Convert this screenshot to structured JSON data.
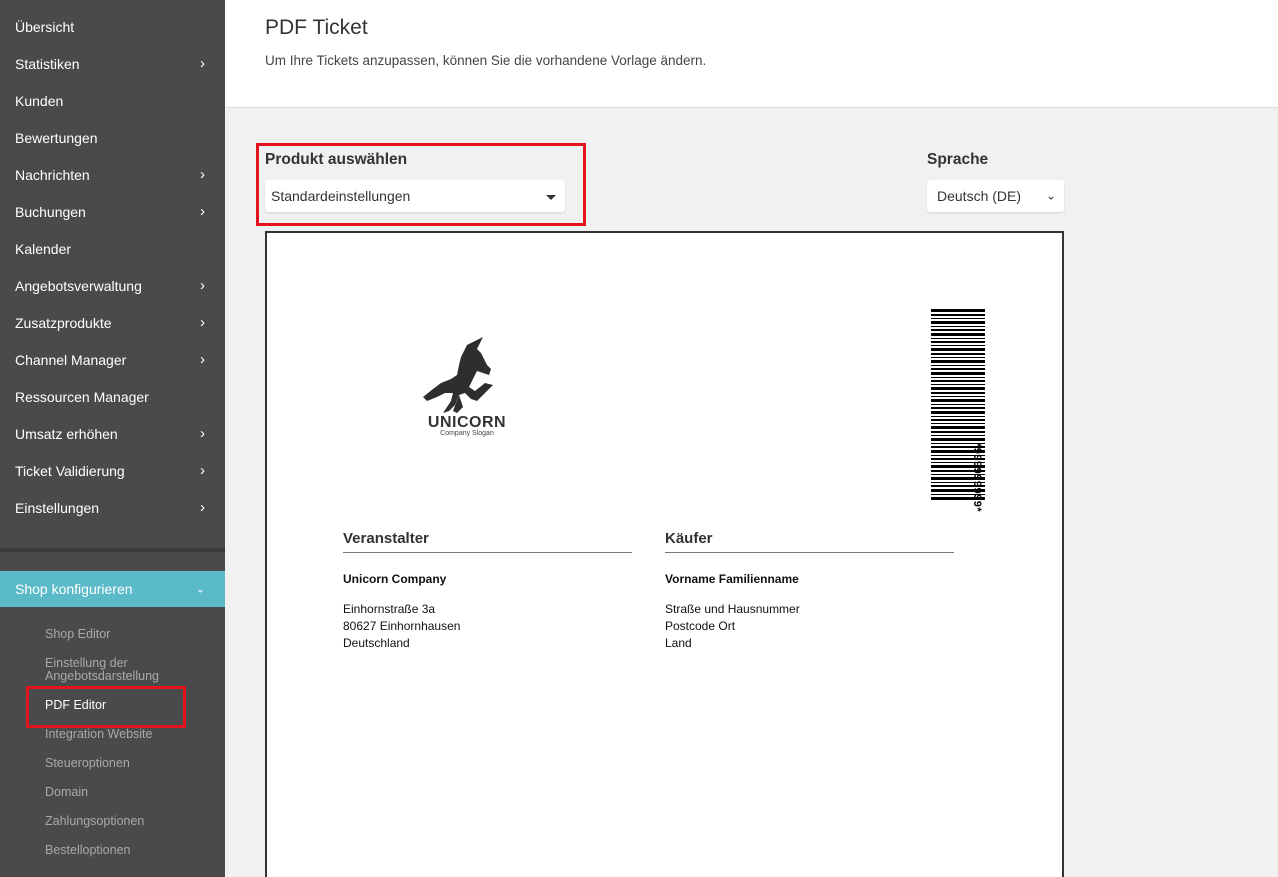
{
  "sidebar": {
    "items": [
      {
        "label": "Übersicht",
        "has_chevron": false
      },
      {
        "label": "Statistiken",
        "has_chevron": true
      },
      {
        "label": "Kunden",
        "has_chevron": false
      },
      {
        "label": "Bewertungen",
        "has_chevron": false
      },
      {
        "label": "Nachrichten",
        "has_chevron": true
      },
      {
        "label": "Buchungen",
        "has_chevron": true
      },
      {
        "label": "Kalender",
        "has_chevron": false
      },
      {
        "label": "Angebotsverwaltung",
        "has_chevron": true
      },
      {
        "label": "Zusatzprodukte",
        "has_chevron": true
      },
      {
        "label": "Channel Manager",
        "has_chevron": true
      },
      {
        "label": "Ressourcen Manager",
        "has_chevron": false
      },
      {
        "label": "Umsatz erhöhen",
        "has_chevron": true
      },
      {
        "label": "Ticket Validierung",
        "has_chevron": true
      },
      {
        "label": "Einstellungen",
        "has_chevron": true
      }
    ],
    "chevron": "›",
    "expanded_section": {
      "label": "Shop konfigurieren",
      "chevron": "⌄",
      "sub_items": [
        {
          "label": "Shop Editor",
          "active": false
        },
        {
          "label": "Einstellung der Angebotsdarstellung",
          "active": false
        },
        {
          "label": "PDF Editor",
          "active": true
        },
        {
          "label": "Integration Website",
          "active": false
        },
        {
          "label": "Steueroptionen",
          "active": false
        },
        {
          "label": "Domain",
          "active": false
        },
        {
          "label": "Zahlungsoptionen",
          "active": false
        },
        {
          "label": "Bestelloptionen",
          "active": false
        }
      ]
    }
  },
  "header": {
    "title": "PDF Ticket",
    "subtitle": "Um Ihre Tickets anzupassen, können Sie die vorhandene Vorlage ändern."
  },
  "controls": {
    "product_label": "Produkt auswählen",
    "product_value": "Standardeinstellungen",
    "language_label": "Sprache",
    "language_value": "Deutsch (DE)",
    "language_chevron": "⌄"
  },
  "ticket": {
    "logo_text": "UNICORN",
    "logo_slogan": "Company Slogan",
    "barcode_number": "*999999999*",
    "organizer": {
      "heading": "Veranstalter",
      "name": "Unicorn Company",
      "address_lines": [
        "Einhornstraße 3a",
        "80627 Einhornhausen",
        "Deutschland"
      ]
    },
    "buyer": {
      "heading": "Käufer",
      "name": "Vorname Familienname",
      "address_lines": [
        "Straße und Hausnummer",
        "Postcode Ort",
        "Land"
      ]
    }
  },
  "colors": {
    "sidebar_bg": "#4a4a4d",
    "accent": "#5bbac8",
    "highlight": "#e3141e"
  }
}
